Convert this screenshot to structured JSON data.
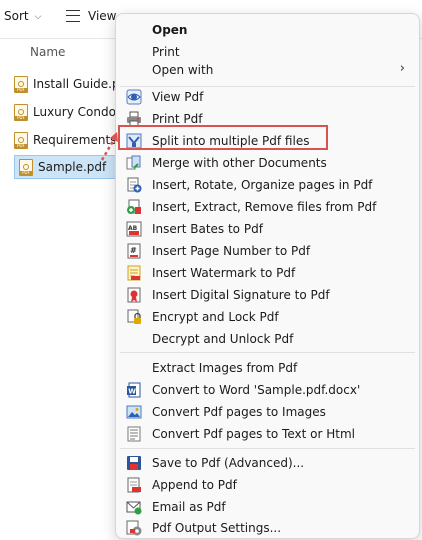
{
  "toolbar": {
    "sort_label": "Sort",
    "view_label": "View"
  },
  "file_list": {
    "column_header": "Name",
    "files": [
      {
        "name": "Install Guide.p"
      },
      {
        "name": "Luxury Condo"
      },
      {
        "name": "Requirements"
      },
      {
        "name": "Sample.pdf"
      }
    ]
  },
  "menu": {
    "open": "Open",
    "print": "Print",
    "open_with": "Open with",
    "submenu_arrow": "›",
    "pdf_items": [
      {
        "label": "View Pdf",
        "icon": "view-pdf-icon"
      },
      {
        "label": "Print Pdf",
        "icon": "printer-icon"
      },
      {
        "label": "Split into multiple Pdf files",
        "icon": "split-pdf-icon"
      },
      {
        "label": "Merge with other Documents",
        "icon": "merge-pdf-icon"
      },
      {
        "label": "Insert, Rotate, Organize pages in Pdf",
        "icon": "organize-pages-icon"
      },
      {
        "label": "Insert, Extract, Remove files from Pdf",
        "icon": "extract-files-icon"
      },
      {
        "label": "Insert Bates to Pdf",
        "icon": "bates-number-icon"
      },
      {
        "label": "Insert Page Number to Pdf",
        "icon": "page-number-icon"
      },
      {
        "label": "Insert Watermark to Pdf",
        "icon": "watermark-icon"
      },
      {
        "label": "Insert Digital Signature to Pdf",
        "icon": "digital-signature-icon"
      },
      {
        "label": "Encrypt and Lock Pdf",
        "icon": "lock-icon"
      },
      {
        "label": "Decrypt and Unlock Pdf",
        "icon": ""
      }
    ],
    "convert_items": [
      {
        "label": "Extract Images from Pdf",
        "icon": ""
      },
      {
        "label": "Convert to Word 'Sample.pdf.docx'",
        "icon": "word-document-icon"
      },
      {
        "label": "Convert Pdf pages to Images",
        "icon": "image-icon"
      },
      {
        "label": "Convert Pdf pages to Text or Html",
        "icon": "text-document-icon"
      }
    ],
    "output_items": [
      {
        "label": "Save to Pdf (Advanced)...",
        "icon": "save-pdf-icon"
      },
      {
        "label": "Append to Pdf",
        "icon": "append-pdf-icon"
      },
      {
        "label": "Email as Pdf",
        "icon": "email-icon"
      },
      {
        "label": "Pdf Output Settings...",
        "icon": "settings-icon"
      }
    ]
  },
  "colors": {
    "highlight_box": "#d9534f",
    "selection": "#cce4f7",
    "menu_bg": "#f9f9f9"
  }
}
